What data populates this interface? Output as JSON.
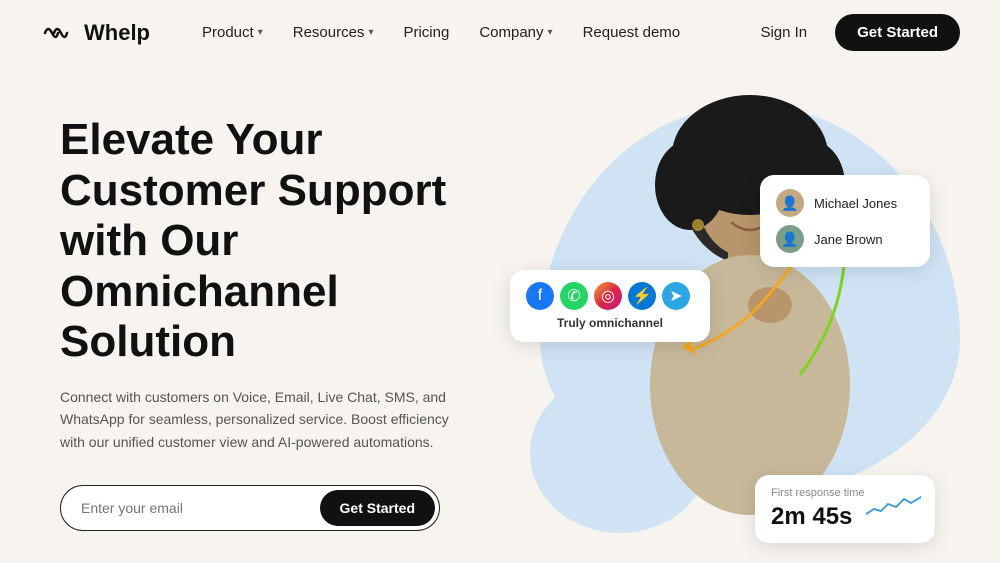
{
  "brand": {
    "name": "Whelp",
    "logo_symbol": "꩜"
  },
  "nav": {
    "links": [
      {
        "label": "Product",
        "has_dropdown": true
      },
      {
        "label": "Resources",
        "has_dropdown": true
      },
      {
        "label": "Pricing",
        "has_dropdown": false
      },
      {
        "label": "Company",
        "has_dropdown": true
      },
      {
        "label": "Request demo",
        "has_dropdown": false
      }
    ],
    "sign_in": "Sign In",
    "get_started": "Get Started"
  },
  "hero": {
    "title": "Elevate Your Customer Support with Our Omnichannel Solution",
    "description": "Connect with customers on Voice, Email, Live Chat, SMS, and WhatsApp for seamless, personalized service. Boost efficiency with our unified customer view and AI-powered automations.",
    "email_placeholder": "Enter your email",
    "cta_button": "Get Started"
  },
  "cards": {
    "omnichannel": {
      "label": "Truly omnichannel"
    },
    "users": [
      {
        "name": "Michael Jones",
        "avatar_color": "#c4a882"
      },
      {
        "name": "Jane Brown",
        "avatar_color": "#7a9e87"
      }
    ],
    "response": {
      "label": "First response time",
      "time": "2m 45s"
    }
  }
}
